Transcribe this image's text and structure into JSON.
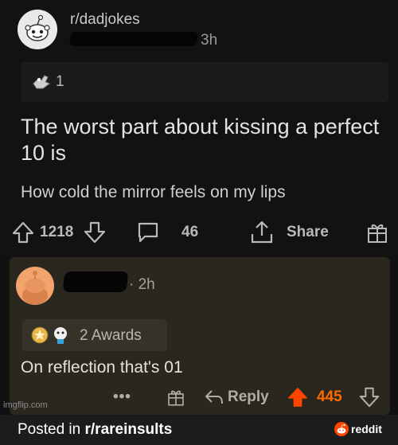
{
  "post": {
    "subreddit": "r/dadjokes",
    "time": "3h",
    "award_count": "1",
    "title": "The worst part about kissing a perfect 10 is",
    "body": "How cold the mirror feels on my lips",
    "score": "1218",
    "comments_count": "46",
    "share_label": "Share"
  },
  "comment": {
    "time": "· 2h",
    "awards_label": "2 Awards",
    "text": "On reflection that's 01",
    "more_label": "•••",
    "reply_label": "Reply",
    "score": "445"
  },
  "watermark": "imgflip.com",
  "footer": {
    "prefix": "Posted in ",
    "subreddit": "r/rareinsults",
    "brand": "reddit"
  },
  "colors": {
    "upvote_orange": "#ff4500",
    "score_orange": "#ff6a00",
    "comment_bg": "#2a271f"
  },
  "icons": [
    "snoo-avatar-icon",
    "award-icon",
    "upvote-icon",
    "downvote-icon",
    "comment-icon",
    "share-icon",
    "gift-icon",
    "reply-icon",
    "reddit-logo-icon"
  ]
}
